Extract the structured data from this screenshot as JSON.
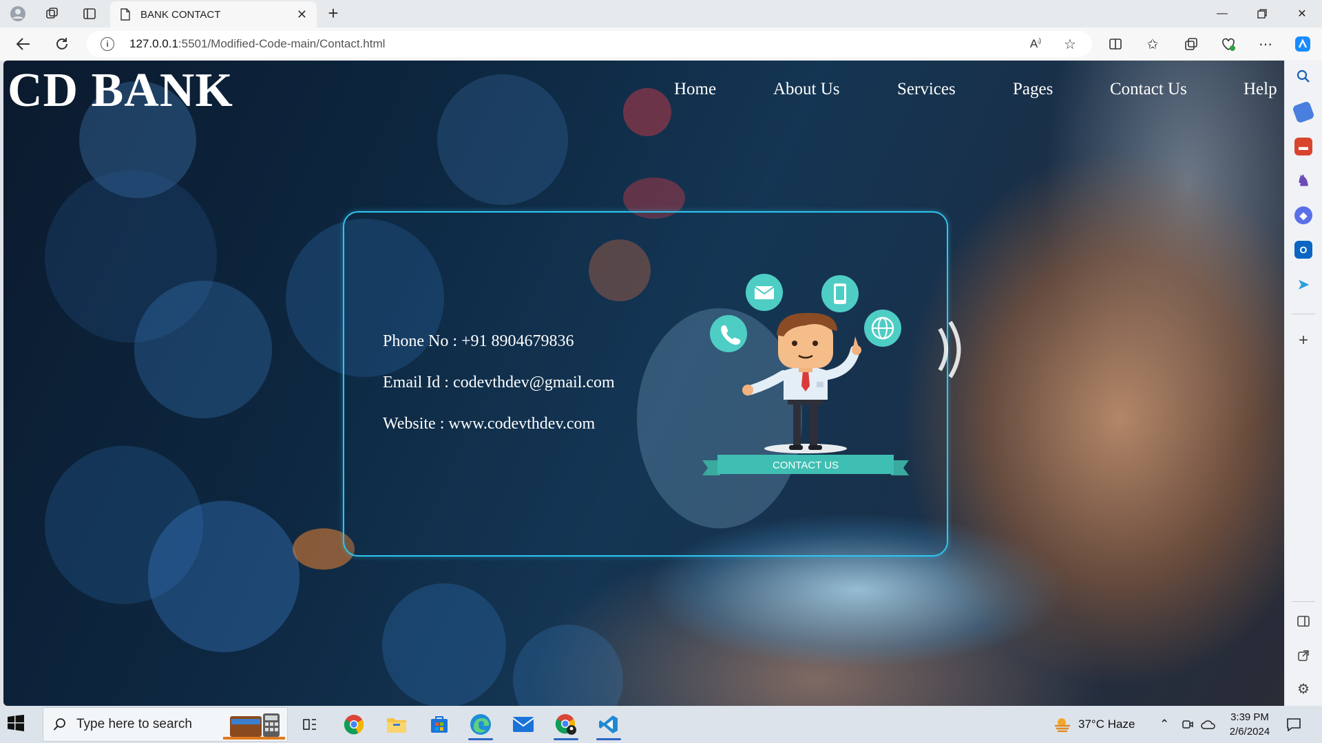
{
  "browser": {
    "tab_title": "BANK CONTACT",
    "url_host": "127.0.0.1",
    "url_rest": ":5501/Modified-Code-main/Contact.html"
  },
  "page": {
    "logo": "CD BANK",
    "nav": [
      "Home",
      "About Us",
      "Services",
      "Pages",
      "Contact Us",
      "Help"
    ],
    "contact": {
      "phone": "Phone No : +91 8904679836",
      "email": "Email Id : codevthdev@gmail.com",
      "website": "Website : www.codevthdev.com"
    },
    "illustration_banner": "CONTACT US"
  },
  "taskbar": {
    "search_placeholder": "Type here to search",
    "weather": "37°C  Haze",
    "time": "3:39 PM",
    "date": "2/6/2024"
  },
  "colors": {
    "card_border": "#2fc6f0",
    "teal": "#4ecdc4",
    "banner_teal": "#3fbfb3"
  }
}
